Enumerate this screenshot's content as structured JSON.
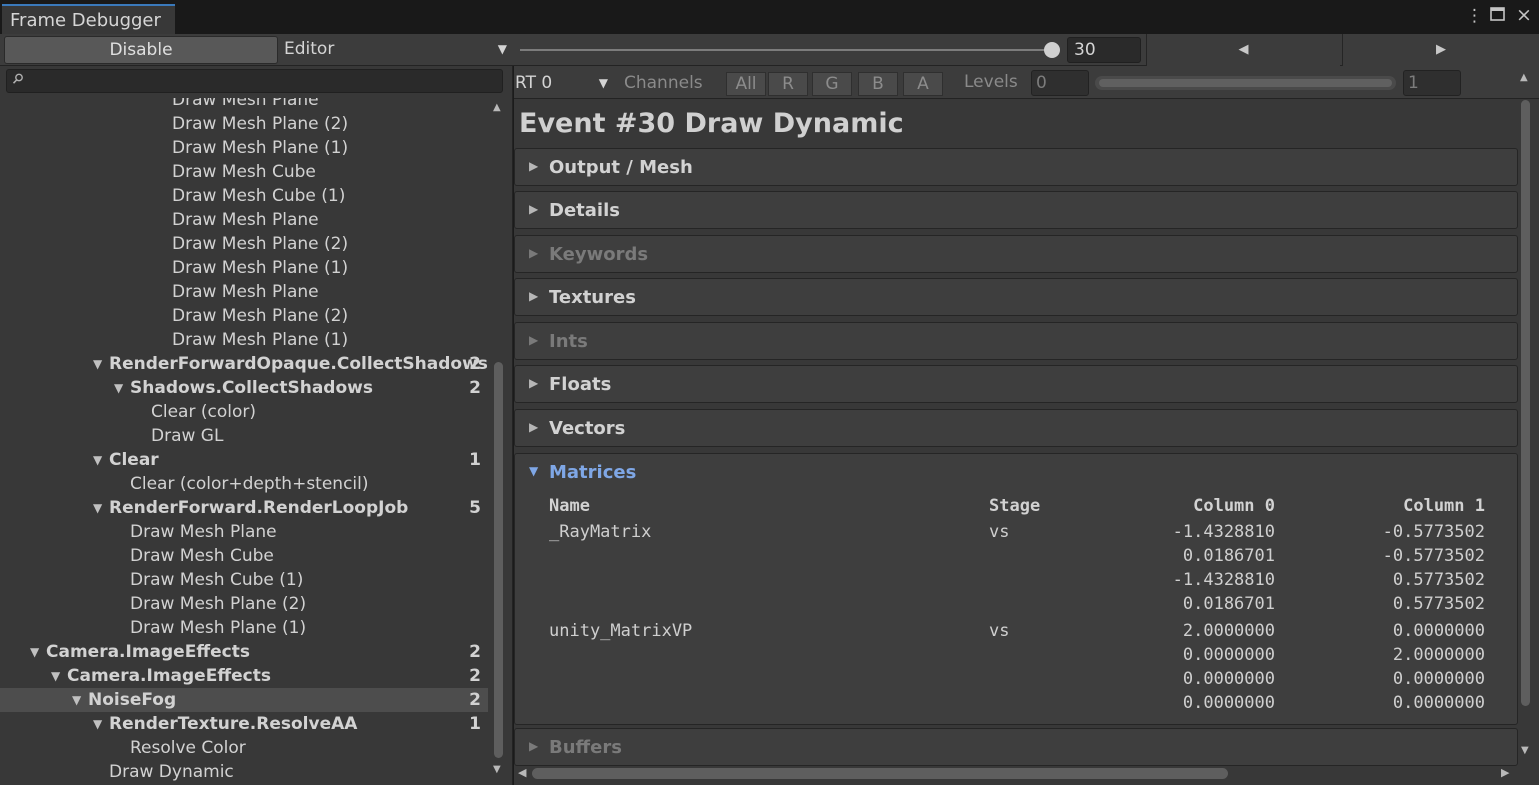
{
  "window": {
    "title": "Frame Debugger",
    "menu_icon": "kebab-menu-icon",
    "maximize_icon": "maximize-icon",
    "close_icon": "close-icon"
  },
  "toolbar": {
    "disable_label": "Disable",
    "target_label": "Editor",
    "event_index": "30",
    "slider_fraction": 1.0,
    "prev_icon": "triangle-left-icon",
    "next_icon": "triangle-right-icon"
  },
  "search": {
    "value": "",
    "placeholder": ""
  },
  "tree": [
    {
      "label": "Draw Mesh Plane",
      "depth": 8,
      "count": "",
      "bold": false,
      "arrow": "none",
      "selected": false
    },
    {
      "label": "Draw Mesh Plane (2)",
      "depth": 8,
      "count": "",
      "bold": false,
      "arrow": "none",
      "selected": false
    },
    {
      "label": "Draw Mesh Plane (1)",
      "depth": 8,
      "count": "",
      "bold": false,
      "arrow": "none",
      "selected": false
    },
    {
      "label": "Draw Mesh Cube",
      "depth": 8,
      "count": "",
      "bold": false,
      "arrow": "none",
      "selected": false
    },
    {
      "label": "Draw Mesh Cube (1)",
      "depth": 8,
      "count": "",
      "bold": false,
      "arrow": "none",
      "selected": false
    },
    {
      "label": "Draw Mesh Plane",
      "depth": 8,
      "count": "",
      "bold": false,
      "arrow": "none",
      "selected": false
    },
    {
      "label": "Draw Mesh Plane (2)",
      "depth": 8,
      "count": "",
      "bold": false,
      "arrow": "none",
      "selected": false
    },
    {
      "label": "Draw Mesh Plane (1)",
      "depth": 8,
      "count": "",
      "bold": false,
      "arrow": "none",
      "selected": false
    },
    {
      "label": "Draw Mesh Plane",
      "depth": 8,
      "count": "",
      "bold": false,
      "arrow": "none",
      "selected": false
    },
    {
      "label": "Draw Mesh Plane (2)",
      "depth": 8,
      "count": "",
      "bold": false,
      "arrow": "none",
      "selected": false
    },
    {
      "label": "Draw Mesh Plane (1)",
      "depth": 8,
      "count": "",
      "bold": false,
      "arrow": "none",
      "selected": false
    },
    {
      "label": "RenderForwardOpaque.CollectShadows",
      "depth": 5,
      "count": "2",
      "bold": true,
      "arrow": "down",
      "selected": false
    },
    {
      "label": "Shadows.CollectShadows",
      "depth": 6,
      "count": "2",
      "bold": true,
      "arrow": "down",
      "selected": false
    },
    {
      "label": "Clear (color)",
      "depth": 7,
      "count": "",
      "bold": false,
      "arrow": "none",
      "selected": false
    },
    {
      "label": "Draw GL",
      "depth": 7,
      "count": "",
      "bold": false,
      "arrow": "none",
      "selected": false
    },
    {
      "label": "Clear",
      "depth": 5,
      "count": "1",
      "bold": true,
      "arrow": "down",
      "selected": false
    },
    {
      "label": "Clear (color+depth+stencil)",
      "depth": 6,
      "count": "",
      "bold": false,
      "arrow": "none",
      "selected": false
    },
    {
      "label": "RenderForward.RenderLoopJob",
      "depth": 5,
      "count": "5",
      "bold": true,
      "arrow": "down",
      "selected": false
    },
    {
      "label": "Draw Mesh Plane",
      "depth": 6,
      "count": "",
      "bold": false,
      "arrow": "none",
      "selected": false
    },
    {
      "label": "Draw Mesh Cube",
      "depth": 6,
      "count": "",
      "bold": false,
      "arrow": "none",
      "selected": false
    },
    {
      "label": "Draw Mesh Cube (1)",
      "depth": 6,
      "count": "",
      "bold": false,
      "arrow": "none",
      "selected": false
    },
    {
      "label": "Draw Mesh Plane (2)",
      "depth": 6,
      "count": "",
      "bold": false,
      "arrow": "none",
      "selected": false
    },
    {
      "label": "Draw Mesh Plane (1)",
      "depth": 6,
      "count": "",
      "bold": false,
      "arrow": "none",
      "selected": false
    },
    {
      "label": "Camera.ImageEffects",
      "depth": 2,
      "count": "2",
      "bold": true,
      "arrow": "down",
      "selected": false
    },
    {
      "label": "Camera.ImageEffects",
      "depth": 3,
      "count": "2",
      "bold": true,
      "arrow": "down",
      "selected": false
    },
    {
      "label": "NoiseFog",
      "depth": 4,
      "count": "2",
      "bold": true,
      "arrow": "down",
      "selected": true
    },
    {
      "label": "RenderTexture.ResolveAA",
      "depth": 5,
      "count": "1",
      "bold": true,
      "arrow": "down",
      "selected": false
    },
    {
      "label": "Resolve Color",
      "depth": 6,
      "count": "",
      "bold": false,
      "arrow": "none",
      "selected": false
    },
    {
      "label": "Draw Dynamic",
      "depth": 5,
      "count": "",
      "bold": false,
      "arrow": "none",
      "selected": false
    }
  ],
  "render_target": {
    "selected": "RT 0",
    "channels_label": "Channels",
    "channels": [
      "All",
      "R",
      "G",
      "B",
      "A"
    ],
    "levels_label": "Levels",
    "levels_min": "0",
    "levels_max": "1"
  },
  "event": {
    "title": "Event #30 Draw Dynamic",
    "sections": [
      {
        "label": "Output / Mesh",
        "enabled": true,
        "expanded": false
      },
      {
        "label": "Details",
        "enabled": true,
        "expanded": false
      },
      {
        "label": "Keywords",
        "enabled": false,
        "expanded": false
      },
      {
        "label": "Textures",
        "enabled": true,
        "expanded": false
      },
      {
        "label": "Ints",
        "enabled": false,
        "expanded": false
      },
      {
        "label": "Floats",
        "enabled": true,
        "expanded": false
      },
      {
        "label": "Vectors",
        "enabled": true,
        "expanded": false
      },
      {
        "label": "Matrices",
        "enabled": true,
        "expanded": true
      },
      {
        "label": "Buffers",
        "enabled": false,
        "expanded": false
      }
    ],
    "matrices": {
      "headers": {
        "name": "Name",
        "stage": "Stage",
        "col0": "Column 0",
        "col1": "Column 1"
      },
      "rows": [
        {
          "name": "_RayMatrix",
          "stage": "vs",
          "col0": [
            "-1.4328810",
            "0.0186701",
            "-1.4328810",
            "0.0186701"
          ],
          "col1": [
            "-0.5773502",
            "-0.5773502",
            "0.5773502",
            "0.5773502"
          ]
        },
        {
          "name": "unity_MatrixVP",
          "stage": "vs",
          "col0": [
            "2.0000000",
            "0.0000000",
            "0.0000000",
            "0.0000000"
          ],
          "col1": [
            "0.0000000",
            "2.0000000",
            "0.0000000",
            "0.0000000"
          ]
        }
      ]
    }
  }
}
